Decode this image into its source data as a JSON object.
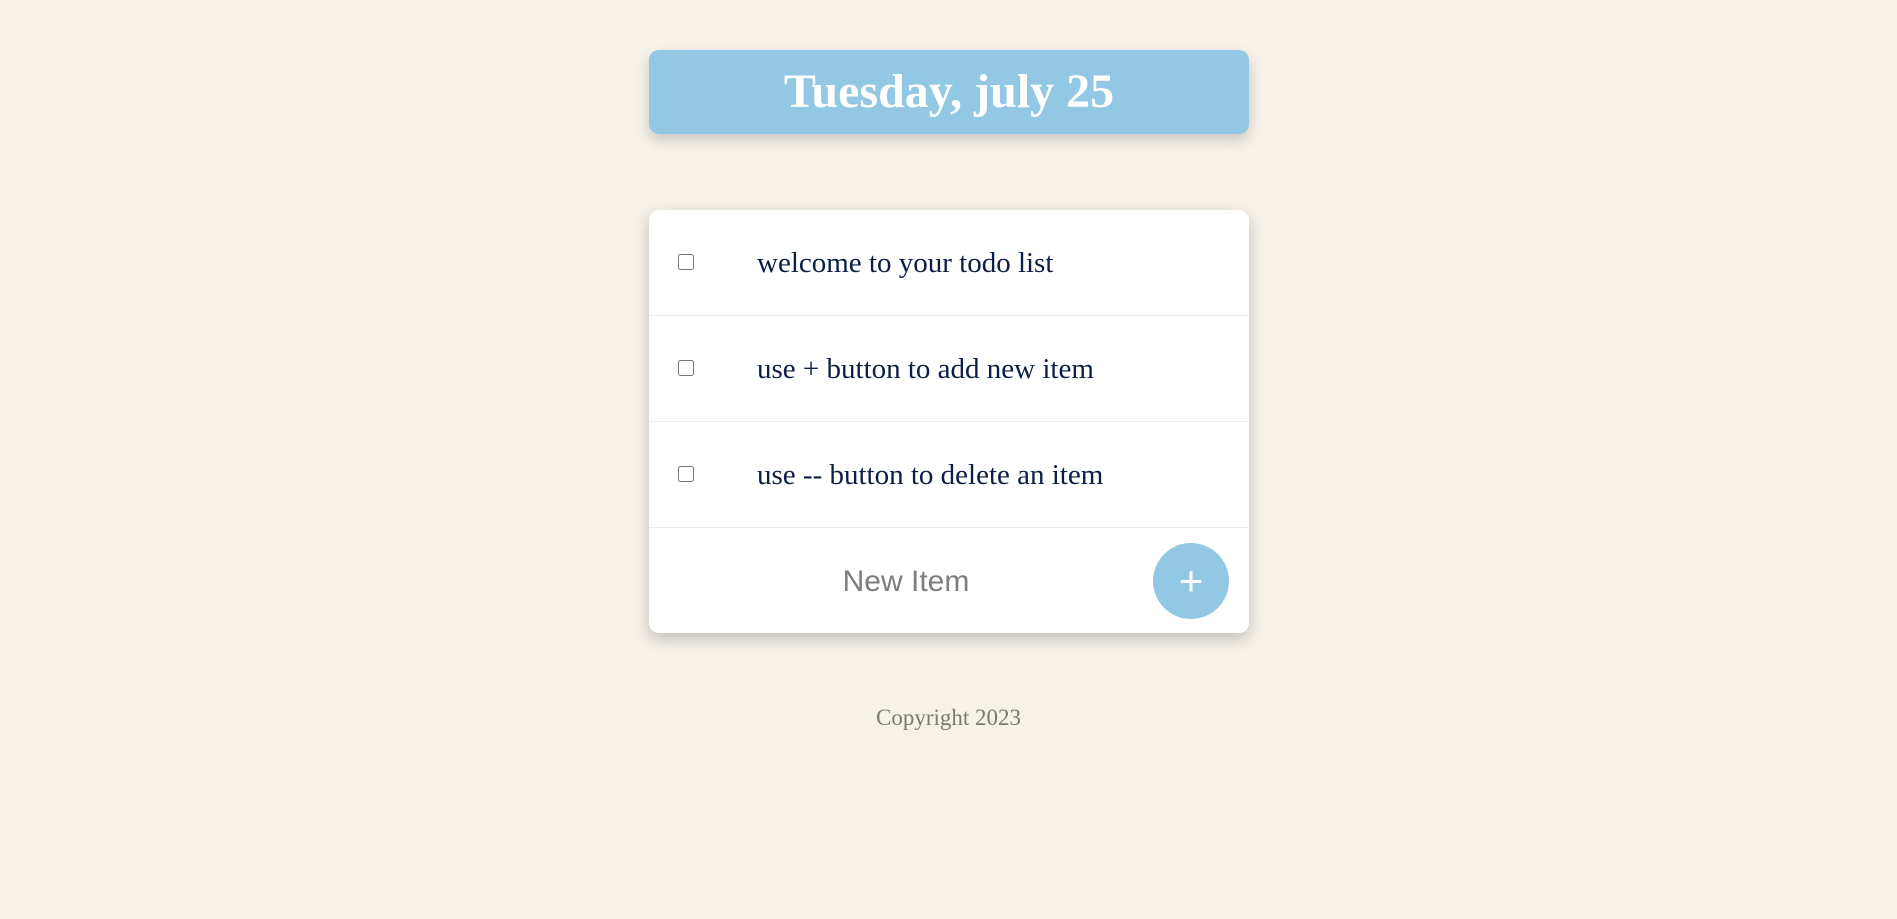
{
  "header": {
    "title": "Tuesday, july 25"
  },
  "todo": {
    "items": [
      {
        "label": "welcome to your todo list",
        "checked": false
      },
      {
        "label": "use + button to add new item",
        "checked": false
      },
      {
        "label": "use -- button to delete an item",
        "checked": false
      }
    ],
    "new_item": {
      "placeholder": "New Item",
      "value": ""
    },
    "add_button_label": "+"
  },
  "footer": {
    "copyright": "Copyright 2023"
  },
  "colors": {
    "background": "#f6f2ea",
    "accent": "#92c8e4",
    "item_text": "#0b1e45",
    "footer_text": "#7a7a6e"
  }
}
